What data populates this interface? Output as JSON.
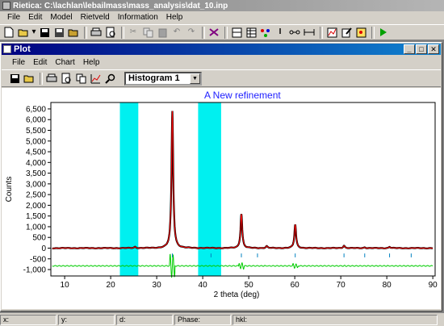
{
  "app": {
    "title": "Rietica: C:\\lachlan\\lebailmass\\mass_analysis\\dat_10.inp",
    "menu": [
      "File",
      "Edit",
      "Model",
      "Rietveld",
      "Information",
      "Help"
    ],
    "toolbar_icons": [
      "new-file-icon",
      "open-folder-icon",
      "save-icon",
      "save-as-icon",
      "open-file-icon",
      "print-icon",
      "print-preview-icon",
      "cut-icon",
      "copy-icon",
      "paste-icon",
      "undo-icon",
      "redo-icon",
      "find-icon",
      "model-icon",
      "table-icon",
      "window-icon",
      "atoms-icon",
      "bond-icon",
      "link-icon",
      "scale-icon",
      "chart-icon",
      "edit-icon",
      "refine-icon",
      "run-icon"
    ]
  },
  "plot_window": {
    "title": "Plot",
    "menu": [
      "File",
      "Edit",
      "Chart",
      "Help"
    ],
    "histogram_selected": "Histogram 1"
  },
  "status": {
    "x": "x:",
    "y": "y:",
    "d": "d:",
    "phase": "Phase:",
    "hkl": "hkl:"
  },
  "chart_data": {
    "type": "line",
    "title": "A New refinement",
    "xlabel": "2 theta (deg)",
    "ylabel": "Counts",
    "xlim": [
      7,
      90.5
    ],
    "ylim": [
      -1300,
      6800
    ],
    "xticks": [
      10,
      20,
      30,
      40,
      50,
      60,
      70,
      80,
      90
    ],
    "yticks": [
      -1000,
      -500,
      0,
      500,
      1000,
      1500,
      2000,
      2500,
      3000,
      3500,
      4000,
      4500,
      5000,
      5500,
      6000,
      6500
    ],
    "ytick_labels": [
      "-1,000",
      "-500",
      "0",
      "500",
      "1,000",
      "1,500",
      "2,000",
      "2,500",
      "3,000",
      "3,500",
      "4,000",
      "4,500",
      "5,000",
      "5,500",
      "6,000",
      "6,500"
    ],
    "excluded_regions": [
      [
        22,
        26
      ],
      [
        39,
        44
      ]
    ],
    "excluded_color": "#00f0f0",
    "peaks": [
      {
        "x": 25.3,
        "y": 60
      },
      {
        "x": 33.4,
        "y": 6400
      },
      {
        "x": 48.4,
        "y": 1600
      },
      {
        "x": 53.9,
        "y": 90
      },
      {
        "x": 60.1,
        "y": 1100
      },
      {
        "x": 70.7,
        "y": 120
      },
      {
        "x": 75.2,
        "y": 40
      },
      {
        "x": 80.6,
        "y": 60
      }
    ],
    "background_level": 0,
    "reflection_markers": [
      33.4,
      41.8,
      48.4,
      51.9,
      60.1,
      70.7,
      75.2,
      80.6,
      85.3
    ],
    "difference_offset": -830,
    "series_colors": {
      "observed": "#000000",
      "calculated": "#ff0000",
      "difference": "#00cc00",
      "markers": "#0080c0"
    }
  }
}
